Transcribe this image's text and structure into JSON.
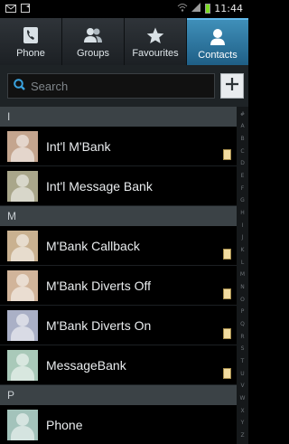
{
  "status_bar": {
    "time": "11:44",
    "icons": [
      "mail-icon",
      "notification-icon",
      "wifi-icon",
      "signal-icon",
      "battery-icon"
    ]
  },
  "tabs": [
    {
      "label": "Phone",
      "icon": "phone-icon",
      "active": false
    },
    {
      "label": "Groups",
      "icon": "groups-icon",
      "active": false
    },
    {
      "label": "Favourites",
      "icon": "star-icon",
      "active": false
    },
    {
      "label": "Contacts",
      "icon": "contact-icon",
      "active": true
    }
  ],
  "search": {
    "placeholder": "Search",
    "add_label": "+"
  },
  "sections": [
    {
      "header": "I",
      "contacts": [
        {
          "name": "Int'l M'Bank",
          "avatar_color": "#c4a58e",
          "sim": true
        },
        {
          "name": "Int'l Message Bank",
          "avatar_color": "#a9a68a",
          "sim": false
        }
      ]
    },
    {
      "header": "M",
      "contacts": [
        {
          "name": "M'Bank Callback",
          "avatar_color": "#c9b190",
          "sim": true
        },
        {
          "name": "M'Bank Diverts Off",
          "avatar_color": "#d1b49a",
          "sim": true
        },
        {
          "name": "M'Bank Diverts On",
          "avatar_color": "#aab0c6",
          "sim": true
        },
        {
          "name": "MessageBank",
          "avatar_color": "#a9c9b9",
          "sim": true
        }
      ]
    },
    {
      "header": "P",
      "contacts": [
        {
          "name": "Phone",
          "avatar_color": "#a3c3bb",
          "sim": false
        }
      ]
    }
  ],
  "index_letters": [
    "#",
    "A",
    "B",
    "C",
    "D",
    "E",
    "F",
    "G",
    "H",
    "I",
    "J",
    "K",
    "L",
    "M",
    "N",
    "O",
    "P",
    "Q",
    "R",
    "S",
    "T",
    "U",
    "V",
    "W",
    "X",
    "Y",
    "Z"
  ],
  "colors": {
    "accent": "#3f8fb9",
    "section_header": "#3b4246",
    "sim_badge": "#f2dca0"
  }
}
